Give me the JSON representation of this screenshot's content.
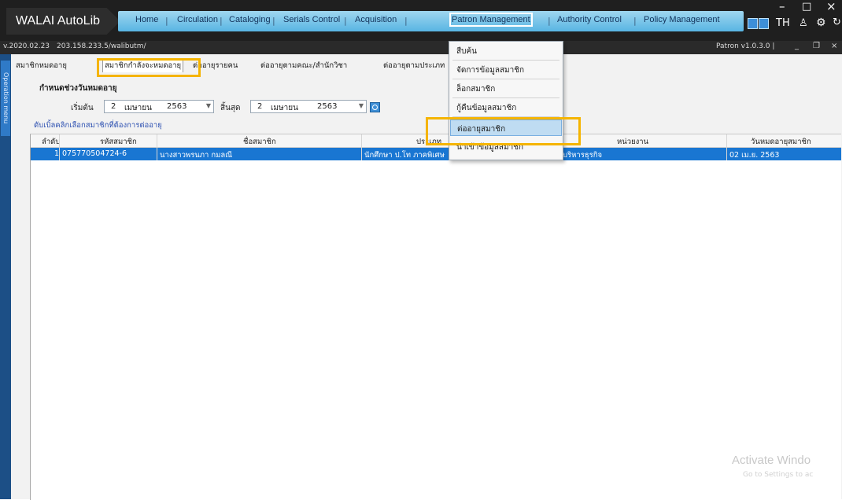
{
  "app": {
    "brand": "WALAI AutoLib",
    "menu": [
      "Home",
      "Circulation",
      "Cataloging",
      "Serials Control",
      "Acquisition",
      "Patron Management",
      "Authority Control",
      "Policy Management"
    ],
    "lang": "TH",
    "window_controls": {
      "minimize": "–",
      "maximize": "□",
      "close": "×"
    }
  },
  "infobar": {
    "version": "v.2020.02.23",
    "server": "203.158.233.5/walibutm/",
    "patron_version": "Patron v1.0.3.0 |",
    "min": "_",
    "restore": "❐",
    "close": "×"
  },
  "siderail": {
    "label": "Operation menu"
  },
  "tabs": [
    "สมาชิกหมดอายุ",
    "สมาชิกกำลังจะหมดอายุ",
    "ต่ออายุรายคน",
    "ต่ออายุตามคณะ/สำนักวิชา",
    "ต่ออายุตามประเภท"
  ],
  "filter": {
    "group_label": "กำหนดช่วงวันหมดอายุ",
    "start_label": "เริ่มต้น",
    "start": {
      "day": "2",
      "month": "เมษายน",
      "year": "2563"
    },
    "end_label": "สิ้นสุด",
    "end": {
      "day": "2",
      "month": "เมษายน",
      "year": "2563"
    },
    "hint": "ดับเบิ้ลคลิกเลือกสมาชิกที่ต้องการต่ออายุ"
  },
  "grid": {
    "headers": [
      "ลำดับ",
      "รหัสสมาชิก",
      "ชื่อสมาชิก",
      "ประเภท",
      "หน่วยงาน",
      "วันหมดอายุสมาชิก"
    ],
    "rows": [
      {
        "no": "1",
        "id": "075770504724-6",
        "name": "นางสาวพรนภา กมลณี",
        "type": "นักศึกษา ป.โท ภาคพิเศษ",
        "dept": "บริหารธุรกิจ",
        "expiry": "02 เม.ย. 2563"
      }
    ]
  },
  "dropdown": {
    "items": [
      "สืบค้น",
      "จัดการข้อมูลสมาชิก",
      "ล็อกสมาชิก",
      "กู้คืนข้อมูลสมาชิก",
      "ต่ออายุสมาชิก",
      "นำเข้าข้อมูลสมาชิก"
    ],
    "hovered": "ต่ออายุสมาชิก"
  },
  "watermark": {
    "title": "Activate Windo",
    "sub": "Go to Settings to ac"
  }
}
